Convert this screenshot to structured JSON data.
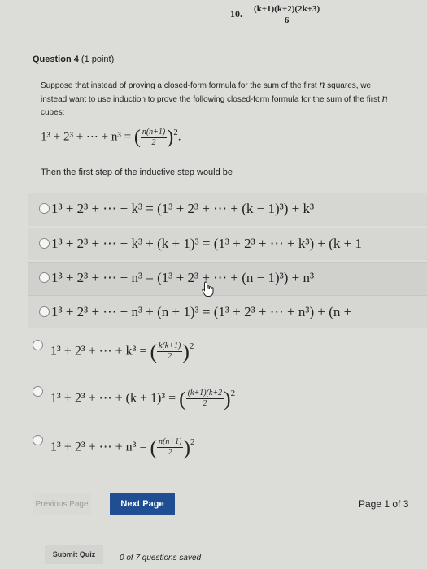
{
  "top": {
    "item_number": "10.",
    "frac_num": "(k+1)(k+2)(2k+3)",
    "frac_den": "6"
  },
  "question": {
    "title": "Question 4",
    "points": "(1 point)",
    "prompt_a": "Suppose that instead of proving a closed-form formula for the sum of the first ",
    "prompt_var1": "n",
    "prompt_b": " squares, we instead want to use induction to prove the following closed-form formula for the sum of the first ",
    "prompt_var2": "n",
    "prompt_c": " cubes:",
    "formula_lhs": "1³ + 2³ + ⋯ + n³ = ",
    "formula_num": "n(n+1)",
    "formula_den": "2",
    "formula_exp": "2",
    "formula_end": ".",
    "then_text": "Then the first step of the inductive step would be"
  },
  "options": [
    {
      "text": "1³ + 2³ + ⋯ + k³ = (1³ + 2³ + ⋯ + (k − 1)³) + k³"
    },
    {
      "text": "1³ + 2³ + ⋯ + k³ + (k + 1)³ = (1³ + 2³ + ⋯ + k³) + (k + 1"
    },
    {
      "text": "1³ + 2³ + ⋯ + n³ = (1³ + 2³ + ⋯ + (n − 1)³) + n³"
    },
    {
      "text": "1³ + 2³ + ⋯ + n³ + (n + 1)³ = (1³ + 2³ + ⋯ + n³) + (n +"
    },
    {
      "lhs": "1³ + 2³ + ⋯ + k³ = ",
      "num": "k(k+1)",
      "den": "2",
      "exp": "2"
    },
    {
      "lhs": "1³ + 2³ + ⋯ + (k + 1)³ = ",
      "num": "(k+1)(k+2",
      "den": "2",
      "exp": "2"
    },
    {
      "lhs": "1³ + 2³ + ⋯ + n³ = ",
      "num": "n(n+1)",
      "den": "2",
      "exp": "2"
    }
  ],
  "nav": {
    "previous": "Previous Page",
    "next": "Next Page",
    "page": "Page 1 of 3",
    "submit": "Submit Quiz",
    "saved": "0 of 7 questions saved"
  }
}
